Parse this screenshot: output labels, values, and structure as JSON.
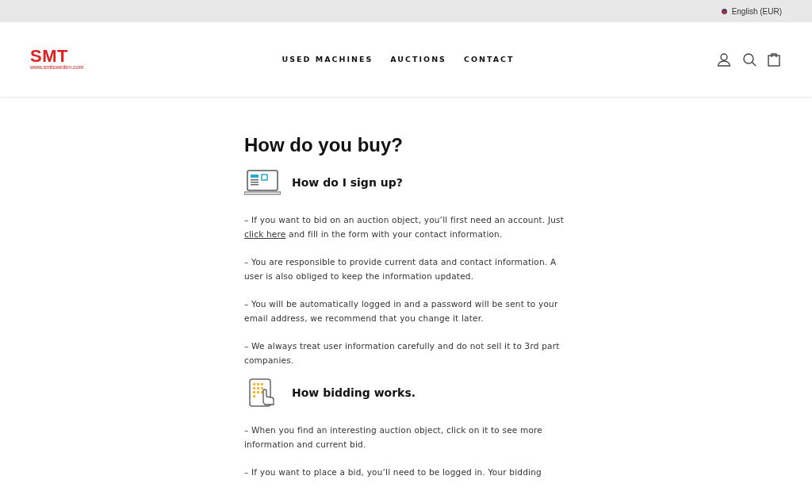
{
  "top_bar": {
    "language": "English (EUR)"
  },
  "header": {
    "logo": {
      "text": "SMT",
      "subtitle": "www.smtsweden.com"
    },
    "nav": [
      {
        "label": "USED MACHINES"
      },
      {
        "label": "AUCTIONS"
      },
      {
        "label": "CONTACT"
      }
    ]
  },
  "page": {
    "title": "How do you buy?",
    "sections": [
      {
        "heading": "How do I sign up?",
        "kind": "laptop",
        "paragraphs": [
          {
            "before": "– If you want to bid on an auction object, you’ll first need an account. Just ",
            "link": "click here",
            "after": " and fill in the form with your contact information."
          },
          {
            "before": "– You are responsible to provide current data and contact information. A user is also obliged to keep the information updated."
          },
          {
            "before": "– You will be automatically logged in and a password will be sent to your email address, we recommend that you change it later."
          },
          {
            "before": "– We always treat user information carefully and do not sell it to 3rd part companies."
          }
        ]
      },
      {
        "heading": "How bidding works.",
        "kind": "tablet",
        "paragraphs": [
          {
            "before": "– When you find an interesting auction object, click on it to see more information and current bid."
          },
          {
            "before": "– If you want to place a bid, you’ll need to be logged in. Your bidding"
          }
        ]
      }
    ]
  }
}
